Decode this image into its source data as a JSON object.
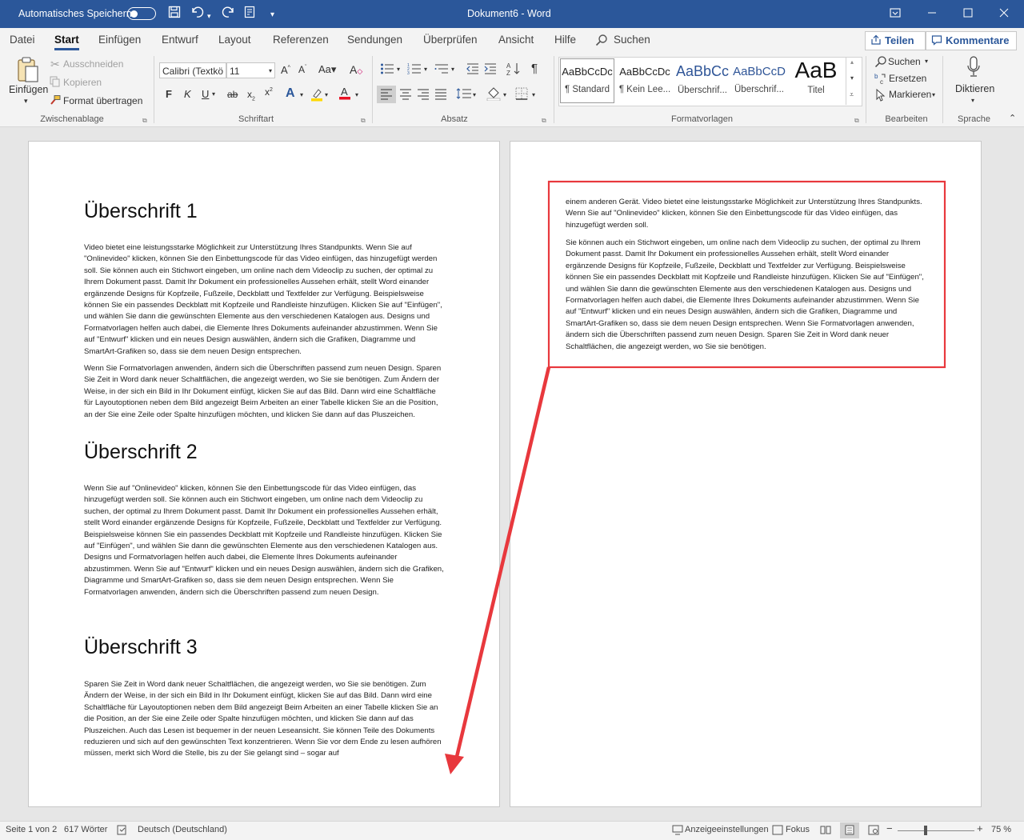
{
  "titlebar": {
    "autosave_label": "Automatisches Speichern",
    "title": "Dokument6 - Word"
  },
  "tabs": [
    "Datei",
    "Start",
    "Einfügen",
    "Entwurf",
    "Layout",
    "Referenzen",
    "Sendungen",
    "Überprüfen",
    "Ansicht",
    "Hilfe"
  ],
  "search_label": "Suchen",
  "share_label": "Teilen",
  "comments_label": "Kommentare",
  "clipboard": {
    "paste": "Einfügen",
    "cut": "Ausschneiden",
    "copy": "Kopieren",
    "format_painter": "Format übertragen",
    "group": "Zwischenablage"
  },
  "font": {
    "name": "Calibri (Textkö",
    "size": "11",
    "bold": "F",
    "italic": "K",
    "underline": "U",
    "strike": "ab",
    "group": "Schriftart"
  },
  "paragraph": {
    "group": "Absatz"
  },
  "styles": {
    "items": [
      {
        "preview": "AaBbCcDc",
        "name": "¶ Standard"
      },
      {
        "preview": "AaBbCcDc",
        "name": "¶ Kein Lee..."
      },
      {
        "preview": "AaBbCc",
        "name": "Überschrif..."
      },
      {
        "preview": "AaBbCcD",
        "name": "Überschrif..."
      },
      {
        "preview": "AaB",
        "name": "Titel"
      }
    ],
    "group": "Formatvorlagen"
  },
  "editing": {
    "find": "Suchen",
    "replace": "Ersetzen",
    "select": "Markieren",
    "group": "Bearbeiten"
  },
  "voice": {
    "dictate": "Diktieren",
    "group": "Sprache"
  },
  "page1": {
    "h1": "Überschrift 1",
    "p1": "Video bietet eine leistungsstarke Möglichkeit zur Unterstützung Ihres Standpunkts. Wenn Sie auf \"Onlinevideo\" klicken, können Sie den Einbettungscode für das Video einfügen, das hinzugefügt werden soll. Sie können auch ein Stichwort eingeben, um online nach dem Videoclip zu suchen, der optimal zu Ihrem Dokument passt. Damit Ihr Dokument ein professionelles Aussehen erhält, stellt Word einander ergänzende Designs für Kopfzeile, Fußzeile, Deckblatt und Textfelder zur Verfügung. Beispielsweise können Sie ein passendes Deckblatt mit Kopfzeile und Randleiste hinzufügen. Klicken Sie auf \"Einfügen\", und wählen Sie dann die gewünschten Elemente aus den verschiedenen Katalogen aus. Designs und Formatvorlagen helfen auch dabei, die Elemente Ihres Dokuments aufeinander abzustimmen. Wenn Sie auf \"Entwurf\" klicken und ein neues Design auswählen, ändern sich die Grafiken, Diagramme und SmartArt-Grafiken so, dass sie dem neuen Design entsprechen.",
    "p2": "Wenn Sie Formatvorlagen anwenden, ändern sich die Überschriften passend zum neuen Design. Sparen Sie Zeit in Word dank neuer Schaltflächen, die angezeigt werden, wo Sie sie benötigen. Zum Ändern der Weise, in der sich ein Bild in Ihr Dokument einfügt, klicken Sie auf das Bild. Dann wird eine Schaltfläche für Layoutoptionen neben dem Bild angezeigt Beim Arbeiten an einer Tabelle klicken Sie an die Position, an der Sie eine Zeile oder Spalte hinzufügen möchten, und klicken Sie dann auf das Pluszeichen.",
    "h2": "Überschrift 2",
    "p3": "Wenn Sie auf \"Onlinevideo\" klicken, können Sie den Einbettungscode für das Video einfügen, das hinzugefügt werden soll. Sie können auch ein Stichwort eingeben, um online nach dem Videoclip zu suchen, der optimal zu Ihrem Dokument passt. Damit Ihr Dokument ein professionelles Aussehen erhält, stellt Word einander ergänzende Designs für Kopfzeile, Fußzeile, Deckblatt und Textfelder zur Verfügung. Beispielsweise können Sie ein passendes Deckblatt mit Kopfzeile und Randleiste hinzufügen. Klicken Sie auf \"Einfügen\", und wählen Sie dann die gewünschten Elemente aus den verschiedenen Katalogen aus. Designs und Formatvorlagen helfen auch dabei, die Elemente Ihres Dokuments aufeinander abzustimmen. Wenn Sie auf \"Entwurf\" klicken und ein neues Design auswählen, ändern sich die Grafiken, Diagramme und SmartArt-Grafiken so, dass sie dem neuen Design entsprechen. Wenn Sie Formatvorlagen anwenden, ändern sich die Überschriften passend zum neuen Design.",
    "h3": "Überschrift 3",
    "p4": "Sparen Sie Zeit in Word dank neuer Schaltflächen, die angezeigt werden, wo Sie sie benötigen. Zum Ändern der Weise, in der sich ein Bild in Ihr Dokument einfügt, klicken Sie auf das Bild. Dann wird eine Schaltfläche für Layoutoptionen neben dem Bild angezeigt Beim Arbeiten an einer Tabelle klicken Sie an die Position, an der Sie eine Zeile oder Spalte hinzufügen möchten, und klicken Sie dann auf das Pluszeichen. Auch das Lesen ist bequemer in der neuen Leseansicht. Sie können Teile des Dokuments reduzieren und sich auf den gewünschten Text konzentrieren. Wenn Sie vor dem Ende zu lesen aufhören müssen, merkt sich Word die Stelle, bis zu der Sie gelangt sind – sogar auf"
  },
  "page2": {
    "p1": "einem anderen Gerät. Video bietet eine leistungsstarke Möglichkeit zur Unterstützung Ihres Standpunkts. Wenn Sie auf \"Onlinevideo\" klicken, können Sie den Einbettungscode für das Video einfügen, das hinzugefügt werden soll.",
    "p2": "Sie können auch ein Stichwort eingeben, um online nach dem Videoclip zu suchen, der optimal zu Ihrem Dokument passt. Damit Ihr Dokument ein professionelles Aussehen erhält, stellt Word einander ergänzende Designs für Kopfzeile, Fußzeile, Deckblatt und Textfelder zur Verfügung. Beispielsweise können Sie ein passendes Deckblatt mit Kopfzeile und Randleiste hinzufügen. Klicken Sie auf \"Einfügen\", und wählen Sie dann die gewünschten Elemente aus den verschiedenen Katalogen aus. Designs und Formatvorlagen helfen auch dabei, die Elemente Ihres Dokuments aufeinander abzustimmen. Wenn Sie auf \"Entwurf\" klicken und ein neues Design auswählen, ändern sich die Grafiken, Diagramme und SmartArt-Grafiken so, dass sie dem neuen Design entsprechen. Wenn Sie Formatvorlagen anwenden, ändern sich die Überschriften passend zum neuen Design. Sparen Sie Zeit in Word dank neuer Schaltflächen, die angezeigt werden, wo Sie sie benötigen."
  },
  "status": {
    "page": "Seite 1 von 2",
    "words": "617 Wörter",
    "language": "Deutsch (Deutschland)",
    "display_settings": "Anzeigeeinstellungen",
    "focus": "Fokus",
    "zoom": "75 %"
  },
  "colors": {
    "title_bar": "#2b579a",
    "annotation": "#e8383d"
  }
}
